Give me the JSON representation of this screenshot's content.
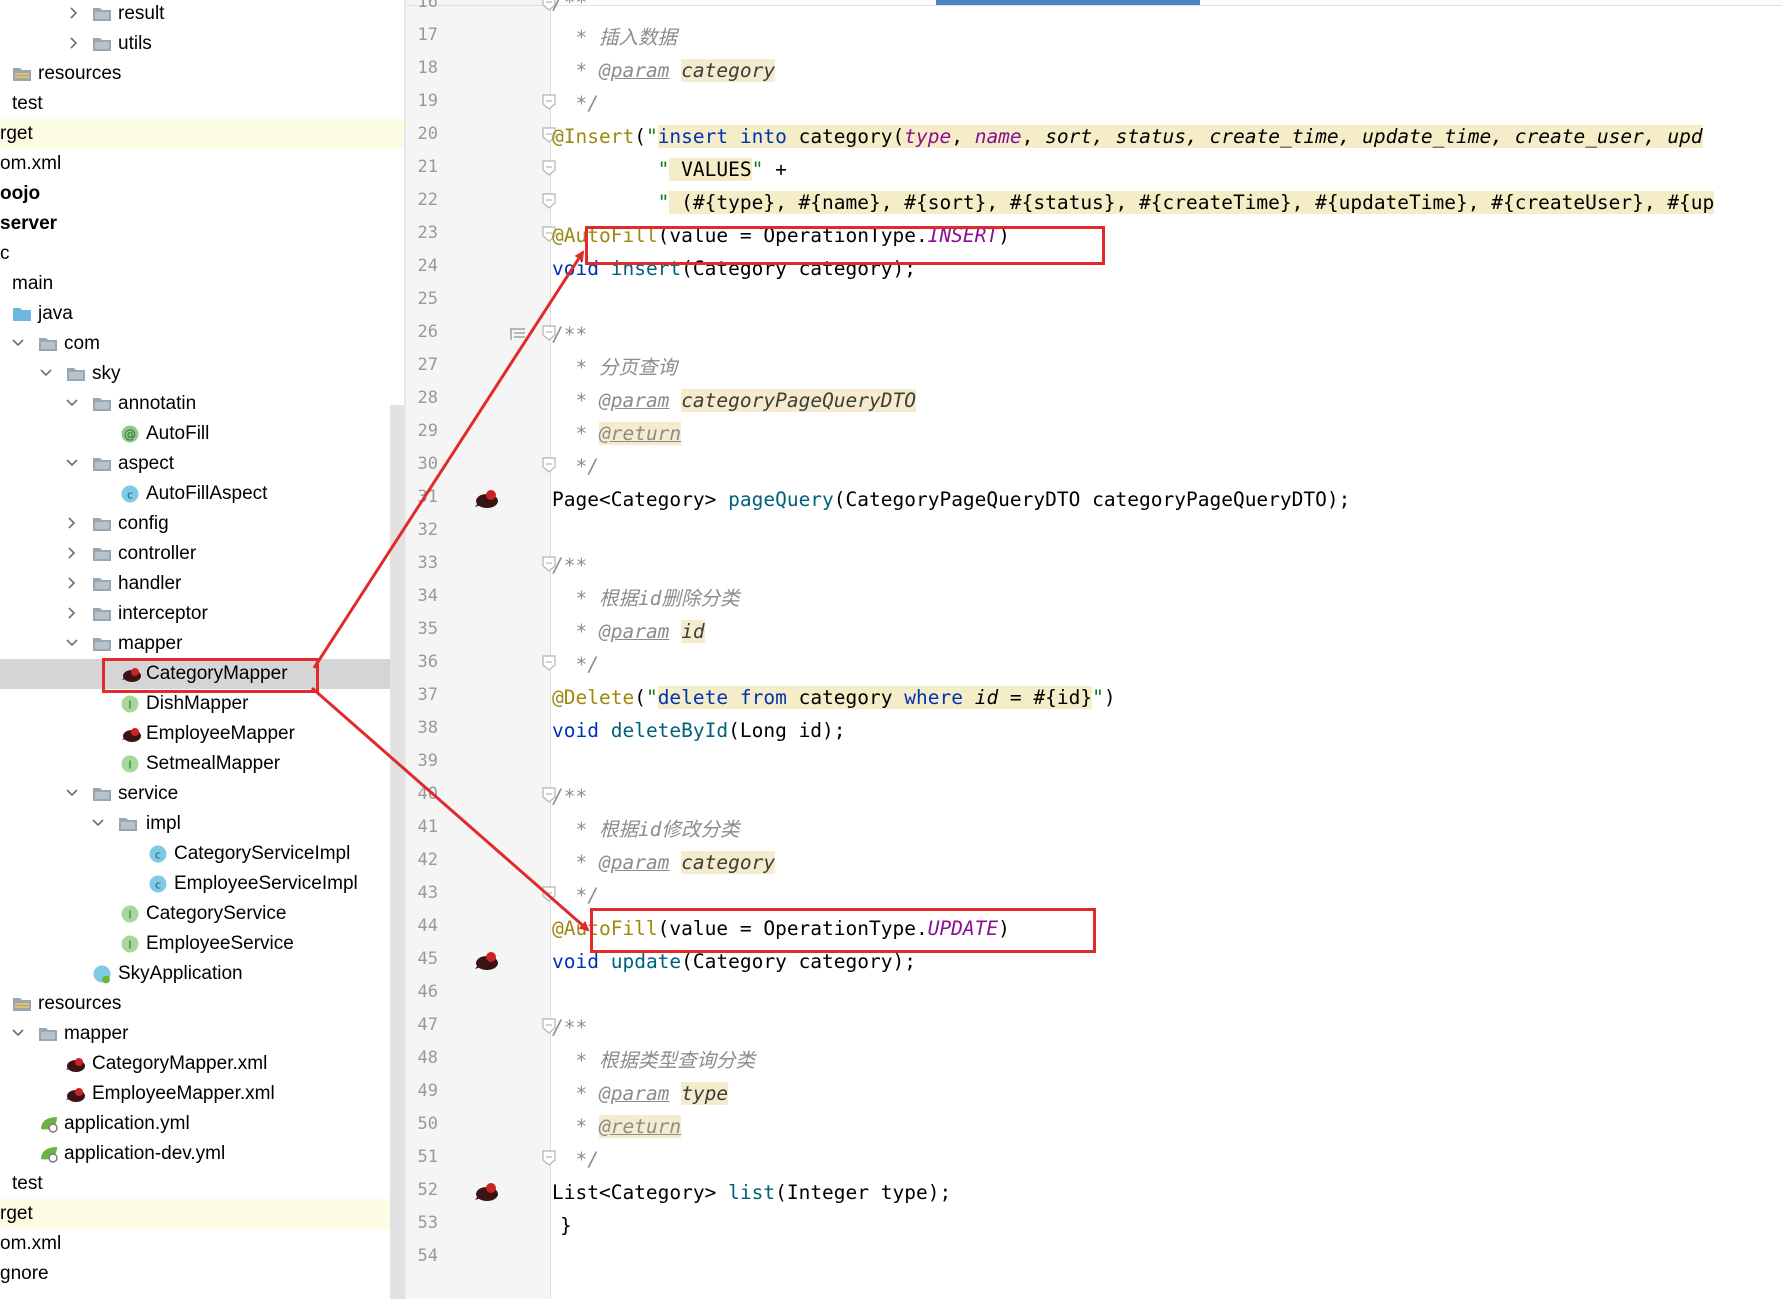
{
  "tree": {
    "rows": [
      {
        "label": "result",
        "arrow": "right",
        "icon": "folder"
      },
      {
        "label": "utils",
        "arrow": "right",
        "icon": "folder"
      },
      {
        "label": "resources",
        "arrow": "",
        "icon": "resources-folder"
      },
      {
        "label": "test",
        "arrow": "",
        "icon": "none"
      },
      {
        "label": "rget",
        "arrow": "",
        "icon": "none"
      },
      {
        "label": "om.xml",
        "arrow": "",
        "icon": "none"
      },
      {
        "label": "oojo",
        "arrow": "",
        "icon": "none"
      },
      {
        "label": "server",
        "arrow": "",
        "icon": "none"
      },
      {
        "label": "c",
        "arrow": "",
        "icon": "none"
      },
      {
        "label": "main",
        "arrow": "",
        "icon": "none"
      },
      {
        "label": "java",
        "arrow": "",
        "icon": "java-folder"
      },
      {
        "label": "com",
        "arrow": "down",
        "icon": "folder"
      },
      {
        "label": "sky",
        "arrow": "down",
        "icon": "folder"
      },
      {
        "label": "annotatin",
        "arrow": "down",
        "icon": "folder"
      },
      {
        "label": "AutoFill",
        "arrow": "",
        "icon": "annotation"
      },
      {
        "label": "aspect",
        "arrow": "down",
        "icon": "folder"
      },
      {
        "label": "AutoFillAspect",
        "arrow": "",
        "icon": "class"
      },
      {
        "label": "config",
        "arrow": "right",
        "icon": "folder"
      },
      {
        "label": "controller",
        "arrow": "right",
        "icon": "folder"
      },
      {
        "label": "handler",
        "arrow": "right",
        "icon": "folder"
      },
      {
        "label": "interceptor",
        "arrow": "right",
        "icon": "folder"
      },
      {
        "label": "mapper",
        "arrow": "down",
        "icon": "folder"
      },
      {
        "label": "CategoryMapper",
        "arrow": "",
        "icon": "mybatis"
      },
      {
        "label": "DishMapper",
        "arrow": "",
        "icon": "interface"
      },
      {
        "label": "EmployeeMapper",
        "arrow": "",
        "icon": "mybatis"
      },
      {
        "label": "SetmealMapper",
        "arrow": "",
        "icon": "interface"
      },
      {
        "label": "service",
        "arrow": "down",
        "icon": "folder"
      },
      {
        "label": "impl",
        "arrow": "down",
        "icon": "folder"
      },
      {
        "label": "CategoryServiceImpl",
        "arrow": "",
        "icon": "class"
      },
      {
        "label": "EmployeeServiceImpl",
        "arrow": "",
        "icon": "class"
      },
      {
        "label": "CategoryService",
        "arrow": "",
        "icon": "interface"
      },
      {
        "label": "EmployeeService",
        "arrow": "",
        "icon": "interface"
      },
      {
        "label": "SkyApplication",
        "arrow": "",
        "icon": "spring-class"
      },
      {
        "label": "resources",
        "arrow": "",
        "icon": "resources-folder"
      },
      {
        "label": "mapper",
        "arrow": "down",
        "icon": "folder"
      },
      {
        "label": "CategoryMapper.xml",
        "arrow": "",
        "icon": "mybatis"
      },
      {
        "label": "EmployeeMapper.xml",
        "arrow": "",
        "icon": "mybatis"
      },
      {
        "label": "application.yml",
        "arrow": "",
        "icon": "spring-yml"
      },
      {
        "label": "application-dev.yml",
        "arrow": "",
        "icon": "spring-yml"
      },
      {
        "label": "test",
        "arrow": "",
        "icon": "none"
      },
      {
        "label": "rget",
        "arrow": "",
        "icon": "none"
      },
      {
        "label": "om.xml",
        "arrow": "",
        "icon": "none"
      },
      {
        "label": "gnore",
        "arrow": "",
        "icon": "none"
      }
    ]
  },
  "editor": {
    "line_numbers": [
      "16",
      "17",
      "18",
      "19",
      "20",
      "21",
      "22",
      "23",
      "24",
      "25",
      "26",
      "27",
      "28",
      "29",
      "30",
      "31",
      "32",
      "33",
      "34",
      "35",
      "36",
      "37",
      "38",
      "39",
      "40",
      "41",
      "42",
      "43",
      "44",
      "45",
      "46",
      "47",
      "48",
      "49",
      "50",
      "51",
      "52",
      "53",
      "54"
    ],
    "comments": {
      "open": "/**",
      "close": "*/",
      "star": "*",
      "insert_desc": "插入数据",
      "page_desc": "分页查询",
      "delete_desc": "根据id删除分类",
      "update_desc": "根据id修改分类",
      "list_desc": "根据类型查询分类",
      "param_tag": "@param",
      "return_tag": "@return",
      "p_category": "category",
      "p_pagedto": "categoryPageQueryDTO",
      "p_id": "id",
      "p_type": "type"
    },
    "insert_annotation": {
      "name": "@Insert",
      "sql1": "insert into category(type, name, sort, status, create_time, update_time, create_user, upd",
      "sql2": " VALUES",
      "plus": " +",
      "sql3": " (#{type}, #{name}, #{sort}, #{status}, #{createTime}, #{updateTime}, #{createUser}, #{up"
    },
    "autofill_insert": {
      "annotation": "@AutoFill",
      "arg": "value = OperationType.",
      "const": "INSERT"
    },
    "insert_method": {
      "ret": "void",
      "name": "insert",
      "params": "(Category category);"
    },
    "page_method": {
      "ret": "Page<Category>",
      "name": "pageQuery",
      "params": "(CategoryPageQueryDTO categoryPageQueryDTO);"
    },
    "delete_annotation": {
      "name": "@Delete",
      "sql": "delete from category where id = #{id}"
    },
    "delete_method": {
      "ret": "void",
      "name": "deleteById",
      "params": "(Long id);"
    },
    "autofill_update": {
      "annotation": "@AutoFill",
      "arg": "value = OperationType.",
      "const": "UPDATE"
    },
    "update_method": {
      "ret": "void",
      "name": "update",
      "params": "(Category category);"
    },
    "list_method": {
      "ret": "List<Category>",
      "name": "list",
      "params": "(Integer type);"
    },
    "closing_brace": "}"
  },
  "colors": {
    "keyword": "#0033b3",
    "string": "#067d17",
    "annotation": "#9e880d",
    "comment": "#8c8c8c",
    "enum_constant": "#871094",
    "method": "#00627a",
    "highlight_box": "#e12a2a",
    "selection": "#d5d5d5"
  }
}
